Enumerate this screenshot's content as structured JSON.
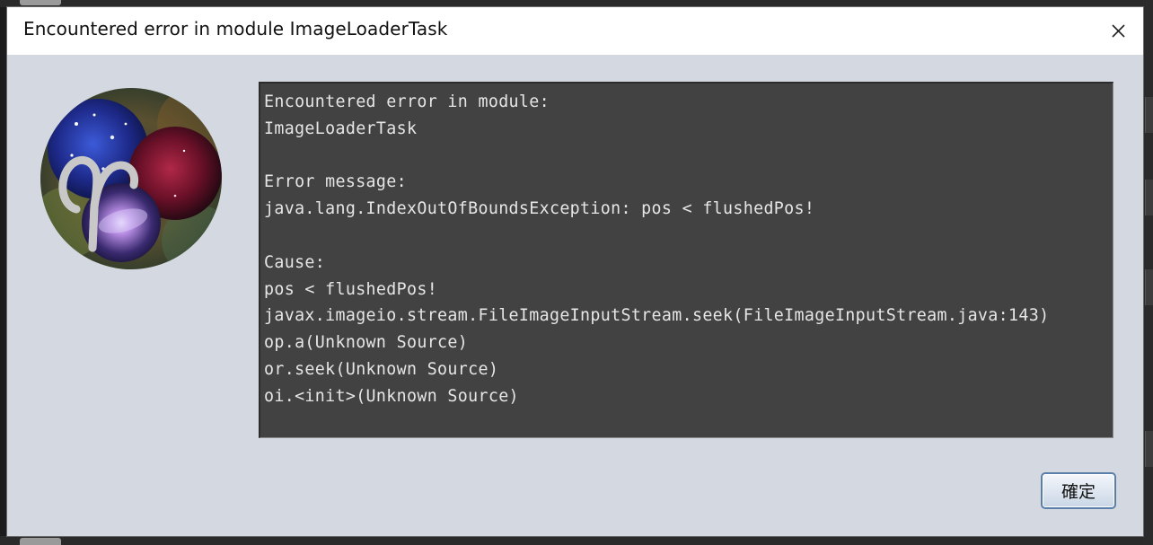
{
  "dialog": {
    "title": "Encountered error in module ImageLoaderTask",
    "close_icon": "close-icon",
    "avatar_icon": "aries-nebula-logo"
  },
  "error_box": {
    "lines": [
      "Encountered error in module:",
      "ImageLoaderTask",
      "",
      "Error message:",
      "java.lang.IndexOutOfBoundsException: pos < flushedPos!",
      "",
      "Cause:",
      "pos < flushedPos!",
      "javax.imageio.stream.FileImageInputStream.seek(FileImageInputStream.java:143)",
      "op.a(Unknown Source)",
      "or.seek(Unknown Source)",
      "oi.<init>(Unknown Source)"
    ]
  },
  "buttons": {
    "ok_label": "確定"
  },
  "colors": {
    "dialog_bg": "#d4d8e1",
    "error_bg": "#424242",
    "error_text": "#e6e6e6",
    "button_border": "#5a7fa9"
  }
}
